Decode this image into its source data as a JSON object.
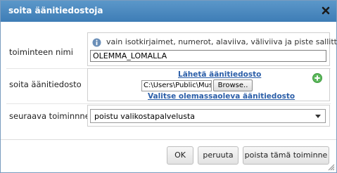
{
  "dialog": {
    "title": "soita äänitiedostoja",
    "close_icon": "close-x-icon"
  },
  "fields": {
    "name": {
      "label": "toiminteen nimi",
      "hint": "vain isotkirjaimet, numerot, alaviiva, väliviiva ja piste sallittuja.",
      "value": "OLEMMA_LOMALLA"
    },
    "audio": {
      "label": "soita äänitiedosto",
      "upload_link": "Lähetä äänitiedosto",
      "file_path": "C:\\Users\\Public\\Music\\Sa",
      "browse_label": "Browse..",
      "choose_link": "Valitse olemassaoleva äänitiedosto",
      "add_icon": "plus-circle-icon"
    },
    "next": {
      "label": "seuraava toiminnne",
      "selected": "poistu valikostapalvelusta"
    }
  },
  "buttons": {
    "ok": "OK",
    "cancel": "peruuta",
    "delete": "poista tämä toiminne"
  },
  "colors": {
    "titlebar": "#4a88be",
    "link": "#2b5ea8",
    "add_icon": "#5cb85c"
  }
}
